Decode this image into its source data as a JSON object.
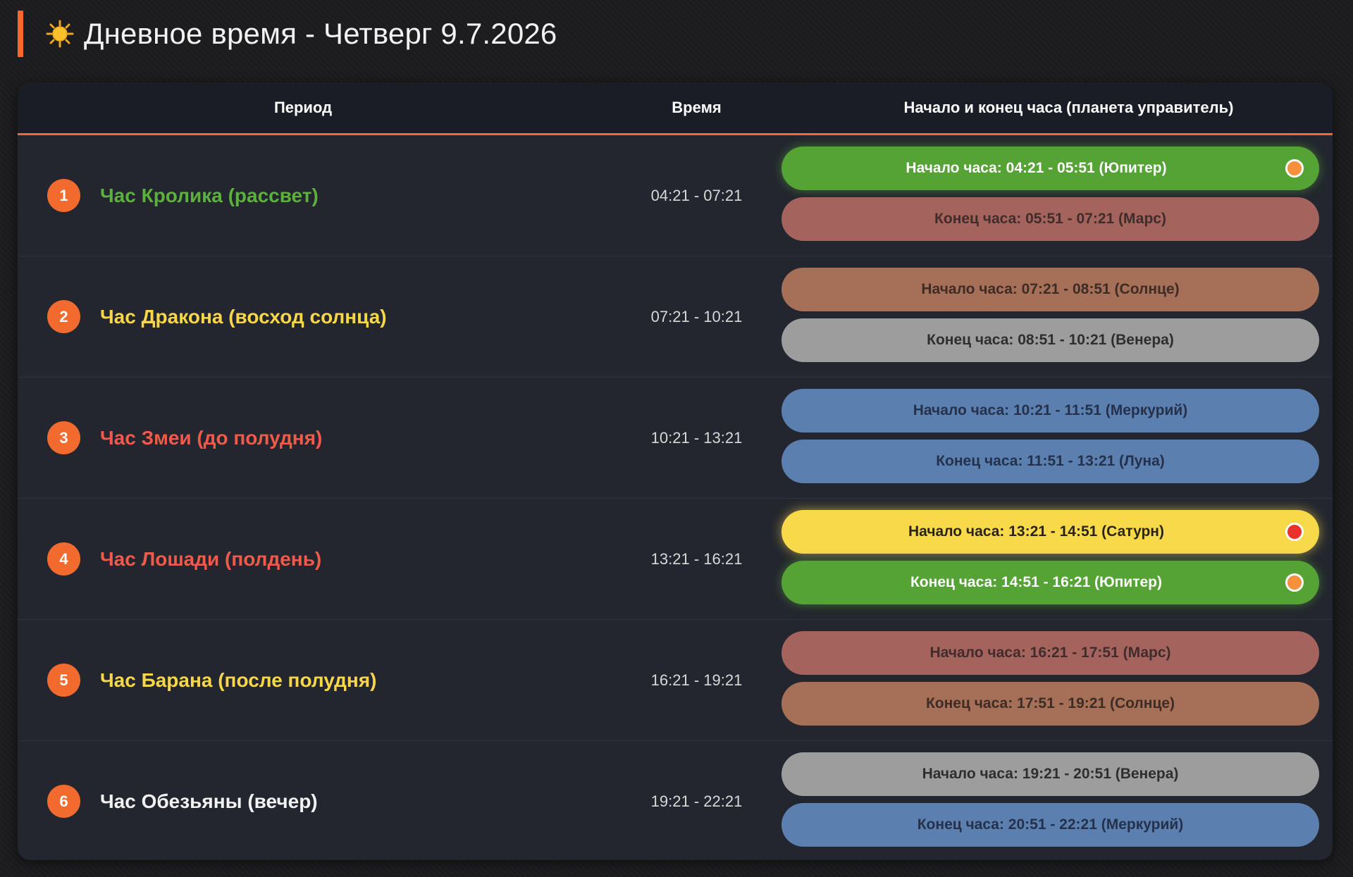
{
  "header": {
    "title": "Дневное время - Четверг 9.7.2026",
    "accent_color": "#f26a2e",
    "icon": "sun-icon"
  },
  "table": {
    "columns": {
      "period": "Период",
      "time": "Время",
      "planet": "Начало и конец часа (планета управитель)"
    },
    "rows": [
      {
        "number": "1",
        "name": "Час Кролика (рассвет)",
        "name_color": "#5cb03c",
        "time": "04:21 - 07:21",
        "start": {
          "label": "Начало часа: 04:21 - 05:51 (Юпитер)",
          "bg": "#55a235",
          "text_color": "#ffffff",
          "dot": "#f5903c",
          "glow": "green"
        },
        "end": {
          "label": "Конец часа: 05:51 - 07:21 (Марс)",
          "bg": "#a4635d",
          "text_color": "#3f2c2b",
          "dot": null,
          "glow": null
        }
      },
      {
        "number": "2",
        "name": "Час Дракона (восход солнца)",
        "name_color": "#f7d64a",
        "time": "07:21 - 10:21",
        "start": {
          "label": "Начало часа: 07:21 - 08:51 (Солнце)",
          "bg": "#a67058",
          "text_color": "#3d2c25",
          "dot": null,
          "glow": null
        },
        "end": {
          "label": "Конец часа: 08:51 - 10:21 (Венера)",
          "bg": "#9d9d9d",
          "text_color": "#2e2e2e",
          "dot": null,
          "glow": null
        }
      },
      {
        "number": "3",
        "name": "Час Змеи (до полудня)",
        "name_color": "#ef5a4a",
        "time": "10:21 - 13:21",
        "start": {
          "label": "Начало часа: 10:21 - 11:51 (Меркурий)",
          "bg": "#5b7fae",
          "text_color": "#25314a",
          "dot": null,
          "glow": null
        },
        "end": {
          "label": "Конец часа: 11:51 - 13:21 (Луна)",
          "bg": "#5b7fae",
          "text_color": "#25314a",
          "dot": null,
          "glow": null
        }
      },
      {
        "number": "4",
        "name": "Час Лошади (полдень)",
        "name_color": "#ef5a4a",
        "time": "13:21 - 16:21",
        "start": {
          "label": "Начало часа: 13:21 - 14:51 (Сатурн)",
          "bg": "#f7d94a",
          "text_color": "#2a2512",
          "dot": "#e8322a",
          "glow": "yellow"
        },
        "end": {
          "label": "Конец часа: 14:51 - 16:21 (Юпитер)",
          "bg": "#55a235",
          "text_color": "#ffffff",
          "dot": "#f5903c",
          "glow": "green"
        }
      },
      {
        "number": "5",
        "name": "Час Барана (после полудня)",
        "name_color": "#f7d64a",
        "time": "16:21 - 19:21",
        "start": {
          "label": "Начало часа: 16:21 - 17:51 (Марс)",
          "bg": "#a4635d",
          "text_color": "#3f2c2b",
          "dot": null,
          "glow": null
        },
        "end": {
          "label": "Конец часа: 17:51 - 19:21 (Солнце)",
          "bg": "#a67058",
          "text_color": "#3d2c25",
          "dot": null,
          "glow": null
        }
      },
      {
        "number": "6",
        "name": "Час Обезьяны (вечер)",
        "name_color": "#f2f2f2",
        "time": "19:21 - 22:21",
        "start": {
          "label": "Начало часа: 19:21 - 20:51 (Венера)",
          "bg": "#9d9d9d",
          "text_color": "#2e2e2e",
          "dot": null,
          "glow": null
        },
        "end": {
          "label": "Конец часа: 20:51 - 22:21 (Меркурий)",
          "bg": "#5b7fae",
          "text_color": "#25314a",
          "dot": null,
          "glow": null
        }
      }
    ]
  }
}
